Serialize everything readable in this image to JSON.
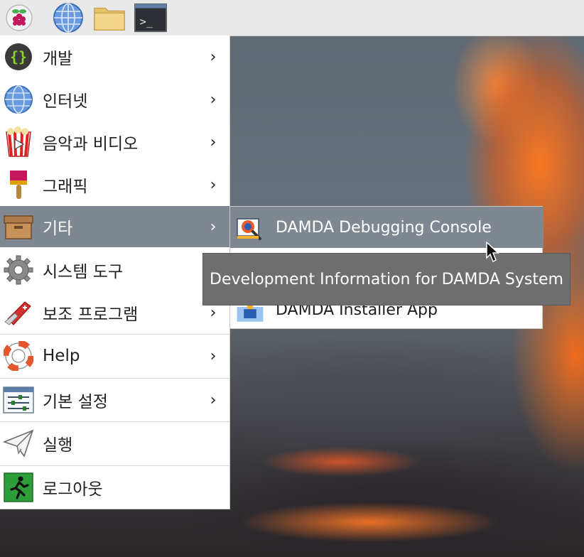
{
  "taskbar": {
    "buttons": [
      {
        "name": "raspberry-menu-icon"
      },
      {
        "name": "web-browser-icon"
      },
      {
        "name": "file-manager-icon"
      },
      {
        "name": "terminal-icon"
      }
    ],
    "terminal_prompt": ">_"
  },
  "menu": {
    "items": [
      {
        "label": "개발",
        "icon": "code-braces-icon",
        "submenu": true
      },
      {
        "label": "인터넷",
        "icon": "globe-icon",
        "submenu": true
      },
      {
        "label": "음악과 비디오",
        "icon": "popcorn-video-icon",
        "submenu": true
      },
      {
        "label": "그래픽",
        "icon": "paint-brush-icon",
        "submenu": true
      },
      {
        "label": "기타",
        "icon": "box-icon",
        "submenu": true,
        "selected": true
      },
      {
        "label": "시스템 도구",
        "icon": "gear-icon",
        "submenu": true
      },
      {
        "label": "보조 프로그램",
        "icon": "swiss-knife-icon",
        "submenu": true
      },
      {
        "label": "Help",
        "icon": "lifebuoy-icon",
        "submenu": true
      },
      {
        "label": "기본 설정",
        "icon": "settings-sliders-icon",
        "submenu": true
      },
      {
        "label": "실행",
        "icon": "paper-plane-icon",
        "submenu": false
      },
      {
        "label": "로그아웃",
        "icon": "exit-running-man-icon",
        "submenu": false
      }
    ],
    "arrow": "›"
  },
  "submenu": {
    "items": [
      {
        "label": "DAMDA Debugging Console",
        "icon": "debug-bug-icon",
        "selected": true
      },
      {
        "label": "DAMDA Installer App",
        "icon": "installer-icon"
      }
    ]
  },
  "tooltip": {
    "text": "Development Information for DAMDA System"
  },
  "colors": {
    "selection": "#7f8791",
    "taskbar": "#e9e9e9",
    "menu_bg": "#ffffff",
    "tooltip_bg": "#6e6e6e"
  }
}
